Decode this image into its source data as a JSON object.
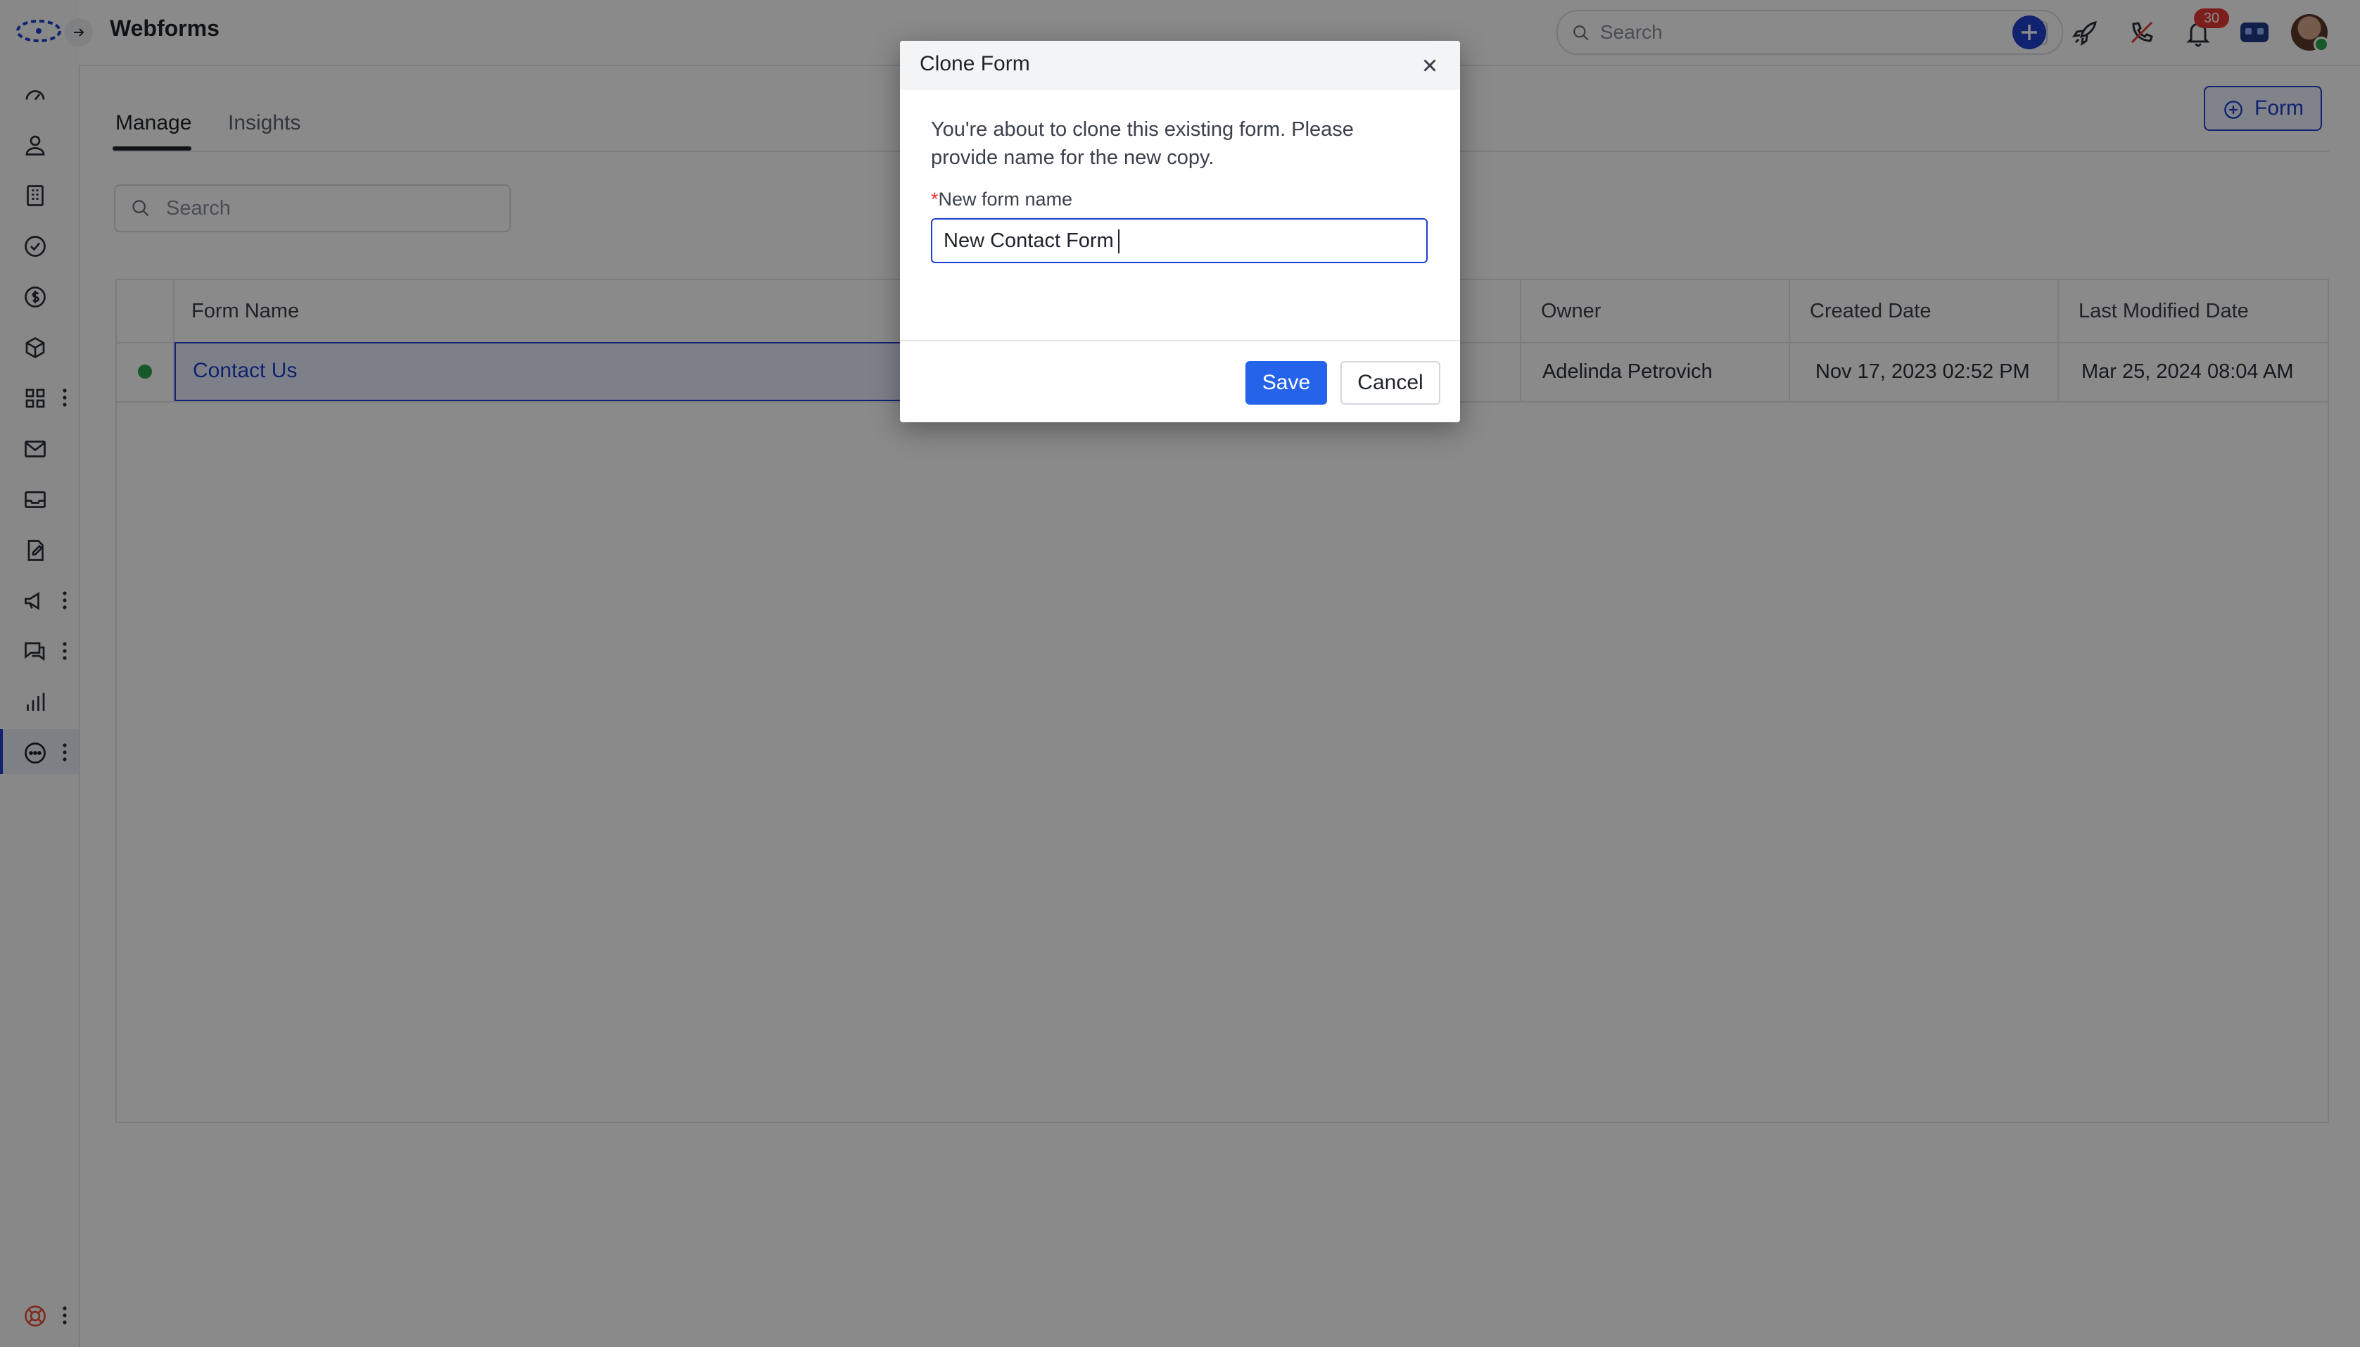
{
  "app": {
    "title": "Webforms"
  },
  "header": {
    "search_placeholder": "Search",
    "search_shortcut": "/",
    "notification_count": "30",
    "icons": [
      "add-icon",
      "rocket-icon",
      "phone-icon",
      "bell-icon",
      "chat-bot-icon",
      "avatar"
    ]
  },
  "sidebar": {
    "items": [
      {
        "icon": "dashboard-icon"
      },
      {
        "icon": "contacts-icon"
      },
      {
        "icon": "accounts-icon"
      },
      {
        "icon": "tasks-icon"
      },
      {
        "icon": "deals-icon"
      },
      {
        "icon": "products-icon"
      },
      {
        "icon": "apps-icon",
        "has_menu": true
      },
      {
        "icon": "email-icon"
      },
      {
        "icon": "inbox-icon"
      },
      {
        "icon": "documents-icon"
      },
      {
        "icon": "campaigns-icon",
        "has_menu": true
      },
      {
        "icon": "conversations-icon",
        "has_menu": true
      },
      {
        "icon": "reports-icon"
      },
      {
        "icon": "more-icon",
        "has_menu": true,
        "active": true
      },
      {
        "icon": "help-icon",
        "has_menu": true
      }
    ]
  },
  "tabs": [
    {
      "label": "Manage",
      "active": true
    },
    {
      "label": "Insights",
      "active": false
    }
  ],
  "toolbar": {
    "add_form_label": "Form",
    "search_placeholder": "Search"
  },
  "table": {
    "columns": [
      "Form Name",
      "Owner",
      "Created Date",
      "Last Modified Date"
    ],
    "rows": [
      {
        "status": "active",
        "form_name": "Contact Us",
        "owner": "Adelinda Petrovich",
        "created": "Nov 17, 2023 02:52 PM",
        "modified": "Mar 25, 2024 08:04 AM"
      }
    ]
  },
  "modal": {
    "title": "Clone Form",
    "description": "You're about to clone this existing form. Please provide name for the new copy.",
    "required_marker": "*",
    "field_label": "New form name",
    "field_value": "New Contact Form",
    "save_label": "Save",
    "cancel_label": "Cancel"
  },
  "colors": {
    "accent": "#1e3fd0",
    "primary_button": "#2563eb",
    "status_active": "#2ea44f",
    "badge": "#e53935"
  }
}
